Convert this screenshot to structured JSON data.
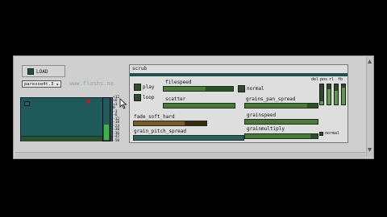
{
  "load_button": {
    "label": "LOAD"
  },
  "file_menu": {
    "value": "paresse4t.3",
    "arrow": "▾"
  },
  "watermark": "www.flashs.ne",
  "scale_labels": [
    "+12",
    "+6",
    "+3",
    "0",
    "-3",
    "-6",
    "-12",
    "-18",
    "-24",
    "-30",
    "-36",
    "-42",
    "-50"
  ],
  "scrub": {
    "title": "scrub"
  },
  "toggles": {
    "play": "play",
    "loop": "loop",
    "normal": "normal"
  },
  "params": {
    "filespeed": {
      "label": "filespeed",
      "value": 0.6
    },
    "scatter": {
      "label": "scatter",
      "value": 1.0
    },
    "grains_pan_spread": {
      "label": "grains_pan_spread",
      "value": 0.85
    },
    "fade_soft_hard": {
      "label": "fade_soft_hard",
      "value": 0.7
    },
    "grainspeed": {
      "label": "grainspeed",
      "value": 1.0
    },
    "grain_pitch_spread": {
      "label": "grain_pitch_spread",
      "value": 1.0
    },
    "grainmultiply": {
      "label": "grainmultiply",
      "value": 0.9
    },
    "normal_small": "normal"
  },
  "mixer": {
    "labels": [
      "del",
      "pos",
      "rl",
      "fb"
    ],
    "levels": [
      0.15,
      0.75,
      0.7,
      0.85
    ]
  },
  "meter": {
    "level": 0.35
  },
  "colors": {
    "accent_green": "#4a7a3a",
    "dark_teal": "#1e5a5a",
    "meter_green": "#3fb43f"
  }
}
